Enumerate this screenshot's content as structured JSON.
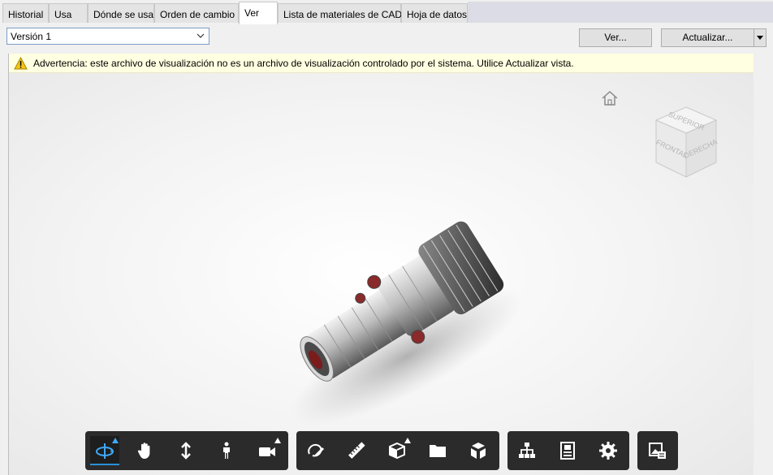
{
  "tabs": [
    {
      "label": "Historial"
    },
    {
      "label": "Usa"
    },
    {
      "label": "Dónde se usa"
    },
    {
      "label": "Orden de cambio"
    },
    {
      "label": "Ver",
      "active": true
    },
    {
      "label": "Lista de materiales de CAD"
    },
    {
      "label": "Hoja de datos"
    }
  ],
  "version_select": {
    "value": "Versión 1"
  },
  "buttons": {
    "view": "Ver...",
    "update": "Actualizar..."
  },
  "warning": {
    "text": "Advertencia: este archivo de visualización no es un archivo de visualización controlado por el sistema. Utilice Actualizar vista."
  },
  "viewcube": {
    "top": "SUPERIOR",
    "front": "FRONTAL",
    "right": "DERECHA"
  },
  "toolbar": {
    "groups": [
      [
        "orbit-icon",
        "pan-hand-icon",
        "zoom-arrows-icon",
        "walk-person-icon",
        "camera-icon"
      ],
      [
        "markup-icon",
        "measure-ruler-icon",
        "section-box-icon",
        "folder-icon",
        "explode-cube-icon"
      ],
      [
        "model-tree-icon",
        "properties-icon",
        "settings-gear-icon"
      ],
      [
        "render-export-icon"
      ]
    ],
    "active": "orbit-icon",
    "accent_color": "#2a8fd8"
  },
  "colors": {
    "warning_bg": "#ffffe1",
    "toolbar_bg": "#2b2b2b"
  }
}
